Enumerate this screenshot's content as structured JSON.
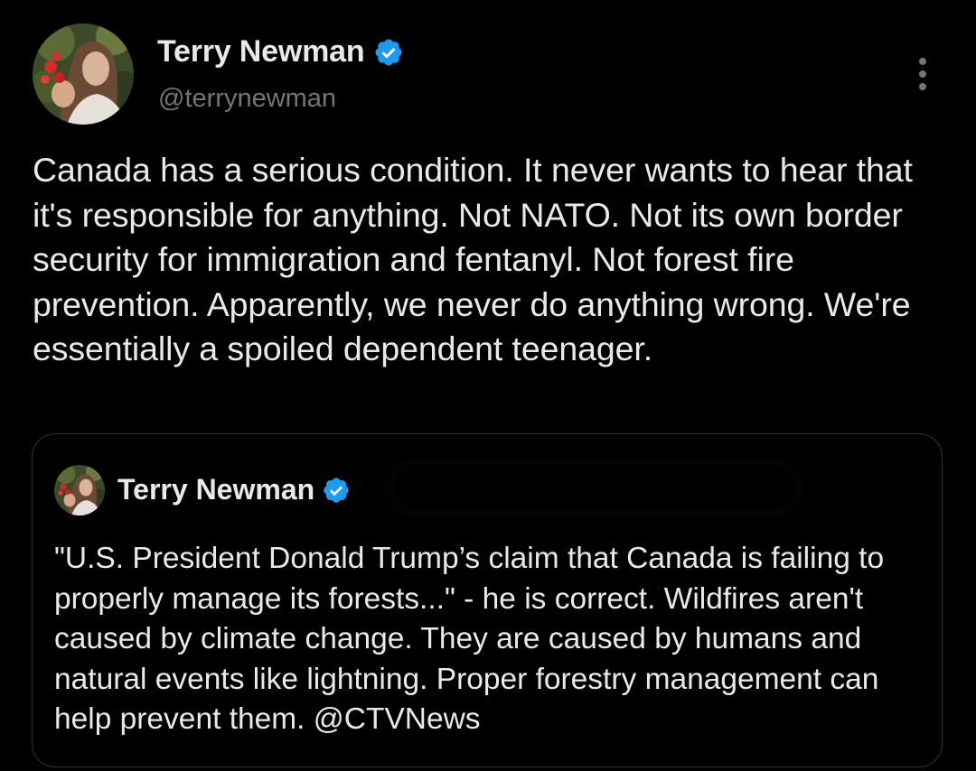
{
  "tweet": {
    "author": {
      "display_name": "Terry Newman",
      "handle": "@terrynewman",
      "verified_icon": "verified-badge-icon",
      "avatar_alt": "avatar"
    },
    "more_icon": "more-options-icon",
    "text": "Canada has a serious condition. It never wants to hear that it's responsible for anything. Not NATO. Not its own border security for immigration and fentanyl. Not forest fire prevention. Apparently, we never do anything wrong. We're essentially a spoiled dependent teenager."
  },
  "quoted_tweet": {
    "author": {
      "display_name": "Terry Newman",
      "verified_icon": "verified-badge-icon"
    },
    "text": "\"U.S. President Donald Trump’s claim that Canada is failing to properly manage its forests...\" - he is correct. Wildfires aren't caused by climate change. They are caused by humans and natural events like lightning.  Proper forestry management can help prevent them.  @CTVNews"
  },
  "colors": {
    "background": "#000000",
    "text_primary": "#e7e9ea",
    "text_secondary": "#71767b",
    "verified_blue": "#1d9bf0",
    "border": "#2f3336"
  }
}
